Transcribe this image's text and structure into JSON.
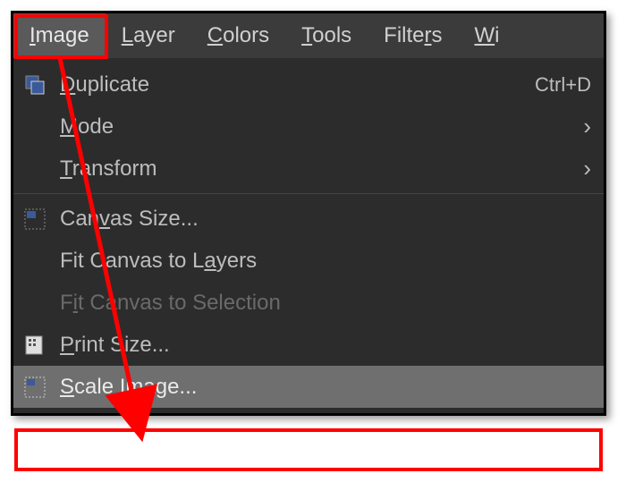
{
  "menubar": {
    "image": "Image",
    "layer": "Layer",
    "colors": "Colors",
    "tools": "Tools",
    "filters": "Filters",
    "windows": "Wi"
  },
  "menu": {
    "duplicate": {
      "label": "Duplicate",
      "shortcut": "Ctrl+D"
    },
    "mode": {
      "label": "Mode"
    },
    "transform": {
      "label": "Transform"
    },
    "canvas_size": {
      "label": "Canvas Size..."
    },
    "fit_layers": {
      "label": "Fit Canvas to Layers"
    },
    "fit_selection": {
      "label": "Fit Canvas to Selection"
    },
    "print_size": {
      "label": "Print Size..."
    },
    "scale_image": {
      "label": "Scale Image..."
    }
  }
}
